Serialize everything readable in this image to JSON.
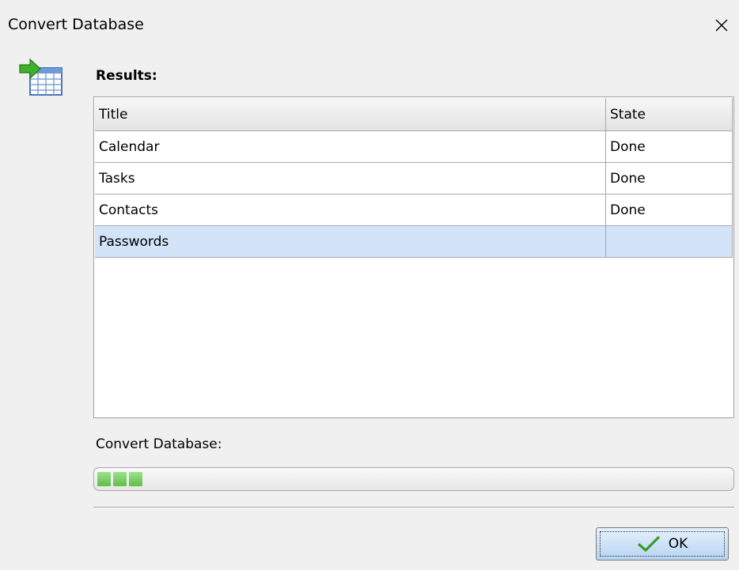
{
  "window": {
    "title": "Convert Database",
    "close_glyph": "✕"
  },
  "results": {
    "label": "Results:",
    "columns": [
      "Title",
      "State"
    ],
    "rows": [
      {
        "title": "Calendar",
        "state": "Done"
      },
      {
        "title": "Tasks",
        "state": "Done"
      },
      {
        "title": "Contacts",
        "state": "Done"
      },
      {
        "title": "Passwords",
        "state": ""
      }
    ],
    "selected_row": "Passwords"
  },
  "progress": {
    "label": "Convert Database:",
    "value_fraction": 0.08,
    "fill_color": "#6cc753"
  },
  "buttons": {
    "ok_label": "OK",
    "ok_icon": "checkmark-icon"
  },
  "colors": {
    "selection": "#d3e3f8",
    "button": "#b6d4f2"
  }
}
